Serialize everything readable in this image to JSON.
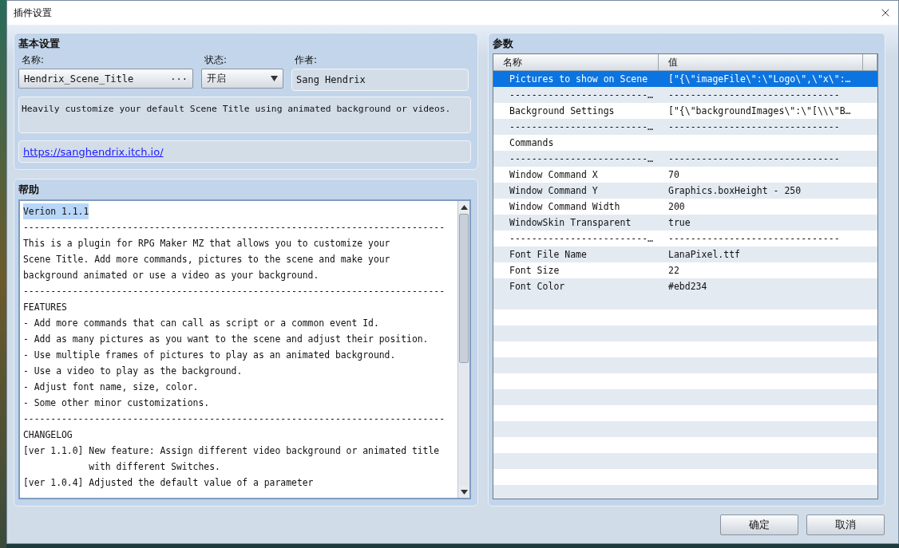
{
  "window": {
    "title": "插件设置"
  },
  "basic_settings": {
    "title": "基本设置",
    "name_label": "名称:",
    "name_value": "Hendrix_Scene_Title",
    "name_button": "···",
    "status_label": "状态:",
    "status_value": "开启",
    "author_label": "作者:",
    "author_value": "Sang Hendrix",
    "description": "Heavily customize your default Scene Title using animated background or videos.",
    "url": "https://sanghendrix.itch.io/"
  },
  "help": {
    "title": "帮助",
    "lines": [
      {
        "text": "Verion 1.1.1",
        "selected": true
      },
      {
        "text": "-----------------------------------------------------------------------------",
        "selected": false
      },
      {
        "text": "This is a plugin for RPG Maker MZ that allows you to customize your",
        "selected": false
      },
      {
        "text": "Scene Title. Add more commands, pictures to the scene and make your",
        "selected": false
      },
      {
        "text": "background animated or use a video as your background.",
        "selected": false
      },
      {
        "text": "-----------------------------------------------------------------------------",
        "selected": false
      },
      {
        "text": "FEATURES",
        "selected": false
      },
      {
        "text": "- Add more commands that can call as script or a common event Id.",
        "selected": false
      },
      {
        "text": "- Add as many pictures as you want to the scene and adjust their position.",
        "selected": false
      },
      {
        "text": "- Use multiple frames of pictures to play as an animated background.",
        "selected": false
      },
      {
        "text": "- Use a video to play as the background.",
        "selected": false
      },
      {
        "text": "- Adjust font name, size, color.",
        "selected": false
      },
      {
        "text": "- Some other minor customizations.",
        "selected": false
      },
      {
        "text": "-----------------------------------------------------------------------------",
        "selected": false
      },
      {
        "text": "CHANGELOG",
        "selected": false
      },
      {
        "text": "[ver 1.1.0] New feature: Assign different video background or animated title",
        "selected": false
      },
      {
        "text": "            with different Switches.",
        "selected": false
      },
      {
        "text": "[ver 1.0.4] Adjusted the default value of a parameter",
        "selected": false
      }
    ]
  },
  "parameters": {
    "title": "参数",
    "columns": [
      "名称",
      "值"
    ],
    "rows": [
      {
        "name": "Pictures to show on Scene",
        "value": "[\"{\\\"imageFile\\\":\\\"Logo\\\",\\\"x\\\":…",
        "selected": true
      },
      {
        "name": "-------------------------…",
        "value": "-------------------------------",
        "selected": false
      },
      {
        "name": "Background Settings",
        "value": "[\"{\\\"backgroundImages\\\":\\\"[\\\\\\\"B…",
        "selected": false
      },
      {
        "name": "-------------------------…",
        "value": "-------------------------------",
        "selected": false
      },
      {
        "name": "Commands",
        "value": "",
        "selected": false
      },
      {
        "name": "-------------------------…",
        "value": "-------------------------------",
        "selected": false
      },
      {
        "name": "Window Command X",
        "value": "70",
        "selected": false
      },
      {
        "name": "Window Command Y",
        "value": "Graphics.boxHeight - 250",
        "selected": false
      },
      {
        "name": "Window Command Width",
        "value": "200",
        "selected": false
      },
      {
        "name": "WindowSkin Transparent",
        "value": "true",
        "selected": false
      },
      {
        "name": "-------------------------…",
        "value": "-------------------------------",
        "selected": false
      },
      {
        "name": "Font File Name",
        "value": "LanaPixel.ttf",
        "selected": false
      },
      {
        "name": "Font Size",
        "value": "22",
        "selected": false
      },
      {
        "name": "Font Color",
        "value": "#ebd234",
        "selected": false
      }
    ]
  },
  "buttons": [
    {
      "label": "确定"
    },
    {
      "label": "取消"
    }
  ]
}
